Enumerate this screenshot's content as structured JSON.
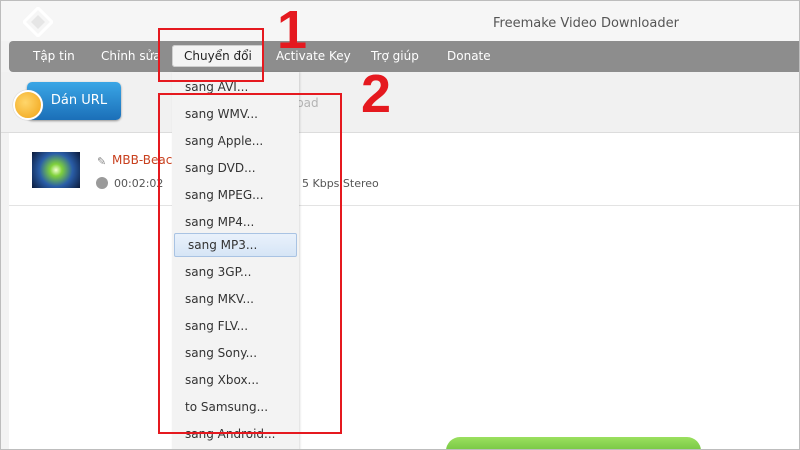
{
  "app": {
    "title": "Freemake Video Downloader"
  },
  "menu": {
    "items": [
      {
        "label": "Tập tin"
      },
      {
        "label": "Chỉnh sửa"
      },
      {
        "label": "Chuyển đổi"
      },
      {
        "label": "Activate Key"
      },
      {
        "label": "Trợ giúp"
      },
      {
        "label": "Donate"
      }
    ]
  },
  "toolbar": {
    "paste_label": "Dán URL",
    "hint_text": "load"
  },
  "file": {
    "name": "MBB-Beac",
    "duration": "00:02:02",
    "bitrate": "5 Kbps  Stereo"
  },
  "dropdown": {
    "items": [
      "sang AVI...",
      "sang WMV...",
      "sang Apple...",
      "sang DVD...",
      "sang MPEG...",
      "sang MP4...",
      "sang MP3...",
      "sang 3GP...",
      "sang MKV...",
      "sang FLV...",
      "sang Sony...",
      "sang  Xbox...",
      "to Samsung...",
      "sang Android..."
    ],
    "highlighted": "sang MP3..."
  },
  "annotations": {
    "label_1": "1",
    "label_2": "2"
  },
  "colors": {
    "annotation": "#e5191f",
    "menubar": "#8d8d8d",
    "accent_blue": "#1b6fb8"
  }
}
